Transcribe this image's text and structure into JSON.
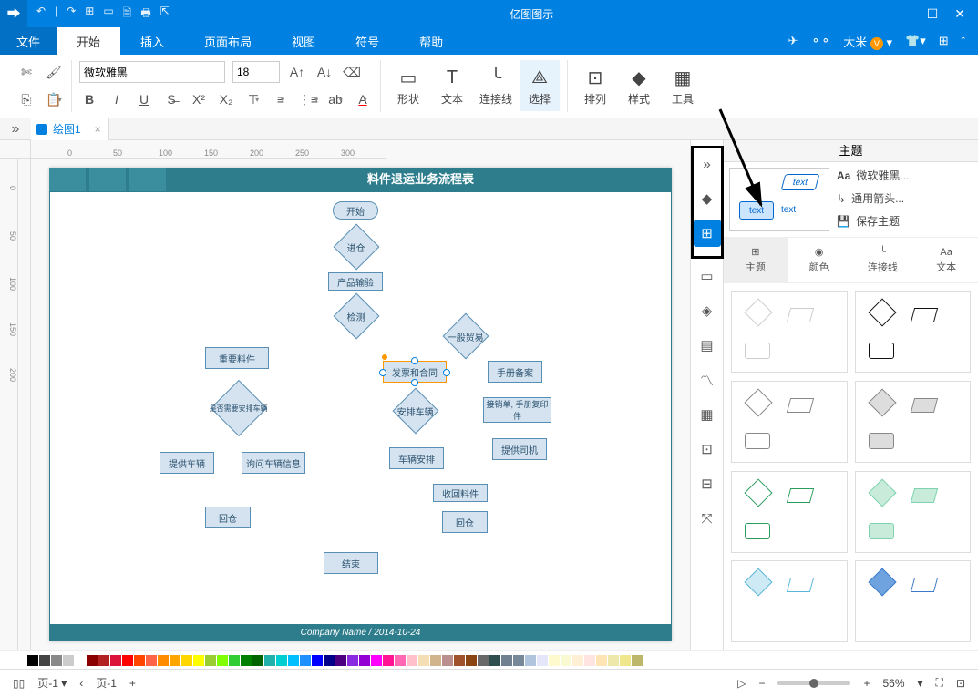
{
  "app_title": "亿图图示",
  "quick_access": [
    "↶",
    "|",
    "↷",
    "⊞",
    "▭",
    "🗎",
    "🖶",
    "⇱"
  ],
  "window_controls": [
    "—",
    "☐",
    "✕"
  ],
  "menu": {
    "file": "文件",
    "items": [
      "开始",
      "插入",
      "页面布局",
      "视图",
      "符号",
      "帮助"
    ],
    "active": 0
  },
  "user_name": "大米",
  "ribbon": {
    "font_name": "微软雅黑",
    "font_size": "18",
    "big_buttons": [
      {
        "icon": "▭",
        "label": "形状"
      },
      {
        "icon": "T",
        "label": "文本"
      },
      {
        "icon": "╰",
        "label": "连接线"
      },
      {
        "icon": "⟁",
        "label": "选择"
      },
      {
        "icon": "⊡",
        "label": "排列"
      },
      {
        "icon": "◆",
        "label": "样式"
      },
      {
        "icon": "▦",
        "label": "工具"
      }
    ]
  },
  "doc_tab": "绘图1",
  "ruler_h": [
    "0",
    "50",
    "100",
    "150",
    "200",
    "250",
    "300"
  ],
  "ruler_v": [
    "0",
    "50",
    "100",
    "150",
    "200"
  ],
  "flowchart": {
    "title": "料件退运业务流程表",
    "footer": "Company Name / 2014-10-24",
    "nodes": {
      "start": "开始",
      "n2": "进仓",
      "n3": "产品输验",
      "n4": "检测",
      "n5": "一般贸易",
      "n6": "重要料件",
      "n7": "是否需要安排车辆",
      "n8": "发票和合同",
      "n9": "手册备案",
      "n10": "安排车辆",
      "n11": "提供车辆",
      "n12": "询问车辆信息",
      "n13": "车辆安排",
      "n14": "接销单, 手册复印件",
      "n15": "提供司机",
      "n16": "收回料件",
      "n17": "回仓",
      "n18": "回仓",
      "n19": "结束"
    }
  },
  "side_icons": [
    "»",
    "◆",
    "⊞",
    "▭",
    "◈",
    "▤",
    "〽",
    "▦",
    "⊡",
    "⊟",
    "⤧"
  ],
  "theme_panel": {
    "title": "主题",
    "preview_text": "text",
    "options": [
      "微软雅黑...",
      "通用箭头...",
      "保存主题"
    ],
    "tabs": [
      "主题",
      "颜色",
      "连接线",
      "文本"
    ],
    "tab_icons": [
      "⊞",
      "◉",
      "╰",
      "Aa"
    ]
  },
  "statusbar": {
    "page_label": "页-1",
    "page_label2": "页-1",
    "zoom": "56%"
  },
  "colors": [
    "#000",
    "#444",
    "#888",
    "#ccc",
    "#fff",
    "#8b0000",
    "#b22222",
    "#dc143c",
    "#ff0000",
    "#ff4500",
    "#ff6347",
    "#ff8c00",
    "#ffa500",
    "#ffd700",
    "#ffff00",
    "#9acd32",
    "#7fff00",
    "#32cd32",
    "#008000",
    "#006400",
    "#20b2aa",
    "#00ced1",
    "#00bfff",
    "#1e90ff",
    "#0000ff",
    "#00008b",
    "#4b0082",
    "#8a2be2",
    "#9400d3",
    "#ff00ff",
    "#ff1493",
    "#ff69b4",
    "#ffc0cb",
    "#f5deb3",
    "#d2b48c",
    "#bc8f8f",
    "#a0522d",
    "#8b4513",
    "#696969",
    "#2f4f4f",
    "#708090",
    "#778899",
    "#b0c4de",
    "#e6e6fa",
    "#fffacd",
    "#fafad2",
    "#ffefd5",
    "#ffe4e1",
    "#ffe4b5",
    "#eee8aa",
    "#f0e68c",
    "#bdb76b"
  ]
}
